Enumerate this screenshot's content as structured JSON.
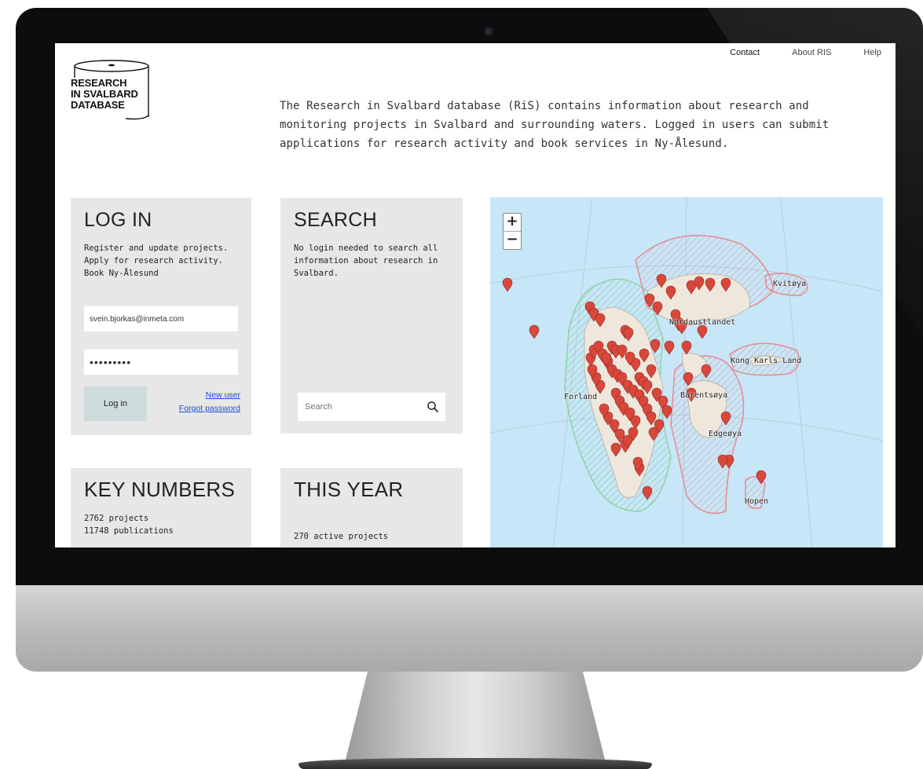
{
  "site": {
    "logo_lines": [
      "RESEARCH",
      "IN SVALBARD",
      "DATABASE"
    ]
  },
  "nav": {
    "contact": "Contact",
    "about": "About RIS",
    "help": "Help"
  },
  "intro": {
    "line1": "The Research in Svalbard database (RiS) contains information about research and",
    "line2": "monitoring projects in Svalbard and surrounding waters. Logged in users can submit",
    "line3": "applications for research activity and book services in Ny-Ålesund."
  },
  "login": {
    "title": "LOG IN",
    "desc": [
      "Register and update projects.",
      "Apply for research activity.",
      "Book Ny-Ålesund"
    ],
    "email_value": "svein.bjorkas@inmeta.com",
    "password_value": "•••••••••",
    "button_label": "Log in",
    "new_user": "New user",
    "forgot_password": "Forgot password"
  },
  "search": {
    "title": "SEARCH",
    "desc": [
      "No login needed to search all",
      "information about research in",
      "Svalbard."
    ],
    "placeholder": "Search",
    "icon": "search-icon"
  },
  "key_numbers": {
    "title": "KEY NUMBERS",
    "lines": [
      "2762 projects",
      "11748 publications"
    ]
  },
  "this_year": {
    "title": "THIS YEAR",
    "lines": [
      "270 active projects"
    ]
  },
  "map": {
    "zoom_in": "+",
    "zoom_out": "−",
    "labels": {
      "kvitoya": "Kvitøya",
      "nordaustlandet": "Nordaustlandet",
      "kong_karls_land": "Kong Karls Land",
      "barentsoya": "Barentsøya",
      "edgeoya": "Edgeøya",
      "hopen": "Hopen",
      "forland": "Forland"
    },
    "colors": {
      "sea": "#c7e6f7",
      "land": "#efe7dc",
      "protected_green": "#8fd3a6",
      "protected_red": "#e48b92",
      "marker": "#d9473b"
    }
  }
}
